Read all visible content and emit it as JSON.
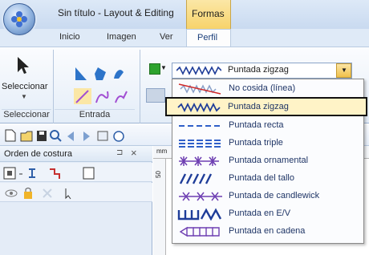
{
  "window": {
    "title": "Sin título - Layout & Editing"
  },
  "context_tab": {
    "label": "Formas"
  },
  "tabs": [
    {
      "label": "Inicio"
    },
    {
      "label": "Imagen"
    },
    {
      "label": "Ver"
    },
    {
      "label": "Perfil"
    }
  ],
  "ribbon": {
    "select_label": "Seleccionar",
    "groups": [
      {
        "label": "Seleccionar"
      },
      {
        "label": "Entrada"
      }
    ],
    "stitch_combo": {
      "value": "Puntada zigzag"
    }
  },
  "dropdown": {
    "options": [
      {
        "label": "No cosida (línea)",
        "icon": "no-stitch-icon"
      },
      {
        "label": "Puntada zigzag",
        "icon": "zigzag-stitch-icon",
        "selected": true
      },
      {
        "label": "Puntada recta",
        "icon": "running-stitch-icon"
      },
      {
        "label": "Puntada triple",
        "icon": "triple-stitch-icon"
      },
      {
        "label": "Puntada ornamental",
        "icon": "motif-stitch-icon"
      },
      {
        "label": "Puntada del tallo",
        "icon": "stem-stitch-icon"
      },
      {
        "label": "Puntada de candlewick",
        "icon": "candlewick-stitch-icon"
      },
      {
        "label": "Puntada en E/V",
        "icon": "ev-stitch-icon"
      },
      {
        "label": "Puntada en cadena",
        "icon": "chain-stitch-icon"
      }
    ]
  },
  "panel": {
    "title": "Orden de costura"
  },
  "ruler": {
    "unit": "mm",
    "v_value": "50"
  },
  "colors": {
    "accent": "#f7d36b",
    "ribbon": "#dfeaf7",
    "stitch": "#1f3d99",
    "selected_row": "#fff3c7"
  }
}
